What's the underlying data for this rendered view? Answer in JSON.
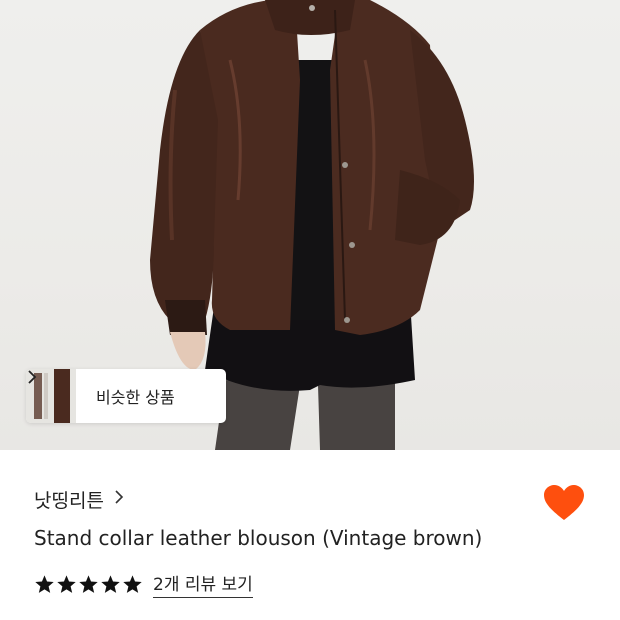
{
  "product": {
    "image_alt": "brown leather jacket worn with black shorts",
    "similar_products_label": "비슷한 상품",
    "brand": "낫띵리튼",
    "title": "Stand collar leather blouson (Vintage brown)",
    "rating_stars": 5,
    "reviews_link": "2개 리뷰 보기",
    "wishlist_icon": "heart-icon",
    "colors": {
      "heart": "#fe4f0e",
      "star": "#111111",
      "jacket": "#4a2a1f"
    }
  }
}
